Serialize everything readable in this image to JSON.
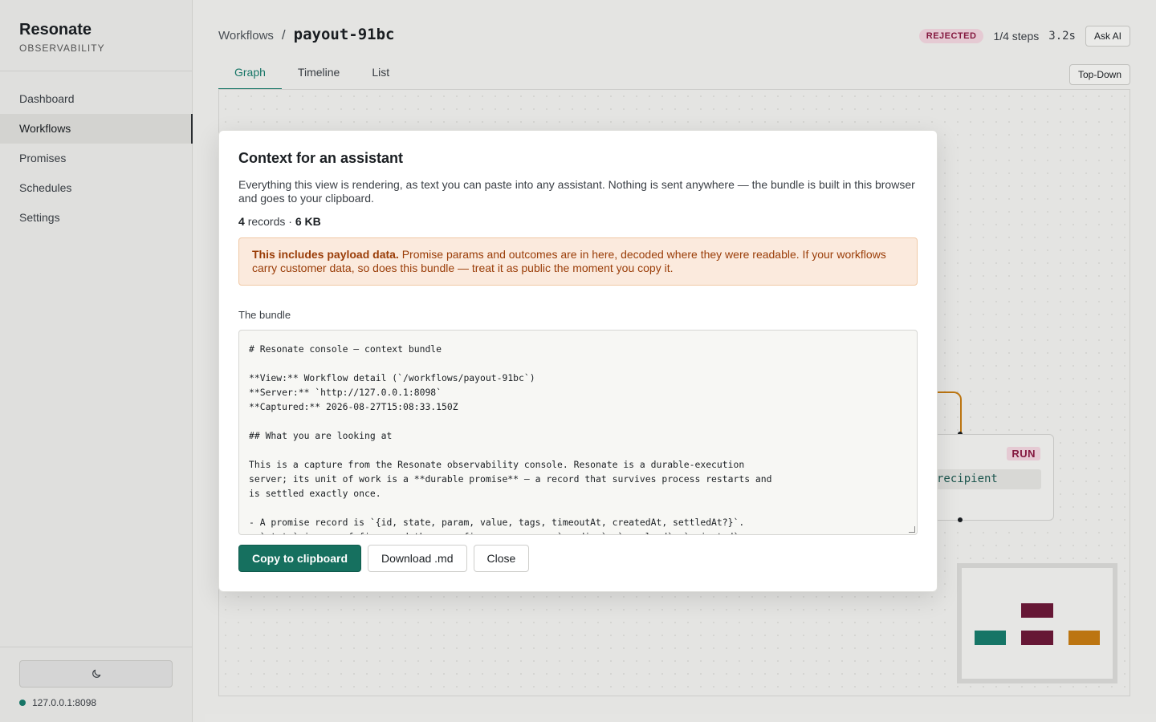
{
  "sidebar": {
    "brand": "Resonate",
    "brand_sub": "OBSERVABILITY",
    "items": [
      {
        "label": "Dashboard"
      },
      {
        "label": "Workflows"
      },
      {
        "label": "Promises"
      },
      {
        "label": "Schedules"
      },
      {
        "label": "Settings"
      }
    ],
    "active_item": "Workflows",
    "theme_icon": "moon-icon",
    "server": "127.0.0.1:8098",
    "server_status_color": "#177a6b"
  },
  "header": {
    "breadcrumb_link": "Workflows",
    "separator": "/",
    "workflow_id": "payout-91bc",
    "status": "REJECTED",
    "steps": "1/4 steps",
    "duration": "3.2s",
    "ask_ai": "Ask AI"
  },
  "tabs": [
    {
      "label": "Graph"
    },
    {
      "label": "Timeline"
    },
    {
      "label": "List"
    }
  ],
  "active_tab": "Graph",
  "layout_toggle": "Top-Down",
  "graph": {
    "node_badge": "RUN",
    "node_function": "recipient"
  },
  "modal": {
    "title": "Context for an assistant",
    "description": "Everything this view is rendering, as text you can paste into any assistant. Nothing is sent anywhere — the bundle is built in this browser and goes to your clipboard.",
    "records_count": "4",
    "records_word": "records",
    "stats_sep": "·",
    "size": "6 KB",
    "warning_bold": "This includes payload data.",
    "warning_text": "Promise params and outcomes are in here, decoded where they were readable. If your workflows carry customer data, so does this bundle — treat it as public the moment you copy it.",
    "bundle_label": "The bundle",
    "bundle_text": "# Resonate console — context bundle\n\n**View:** Workflow detail (`/workflows/payout-91bc`)\n**Server:** `http://127.0.0.1:8098`\n**Captured:** 2026-08-27T15:08:33.150Z\n\n## What you are looking at\n\nThis is a capture from the Resonate observability console. Resonate is a durable-execution\nserver; its unit of work is a **durable promise** — a record that survives process restarts and\nis settled exactly once.\n\n- A promise record is `{id, state, param, value, tags, timeoutAt, createdAt, settledAt?}`.\n  `state` is one of five, and they are five on purpose: `pending`, `resolved`, `rejected`,",
    "copy_button": "Copy to clipboard",
    "download_button": "Download .md",
    "close_button": "Close"
  },
  "colors": {
    "accent": "#16705f",
    "rejected": "#8a1a42",
    "warning": "#9a3d08"
  }
}
